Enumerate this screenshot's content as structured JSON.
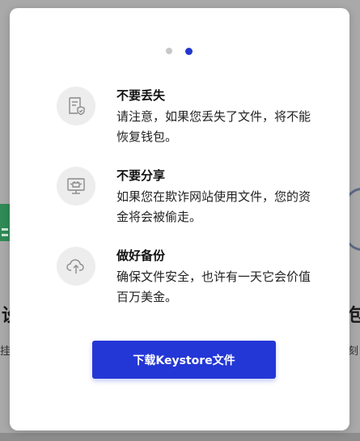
{
  "background": {
    "left_heading": "设",
    "left_sub": "挂",
    "right_heading": "包",
    "right_sub": "刻"
  },
  "pagination": {
    "total": 2,
    "active": 2
  },
  "items": [
    {
      "title": "不要丢失",
      "description": "请注意，如果您丢失了文件，将不能恢复钱包。",
      "icon": "document-shield-icon"
    },
    {
      "title": "不要分享",
      "description": "如果您在欺诈网站使用文件，您的资金将会被偷走。",
      "icon": "monitor-phishing-icon"
    },
    {
      "title": "做好备份",
      "description": "确保文件安全，也许有一天它会价值百万美金。",
      "icon": "cloud-upload-icon"
    }
  ],
  "download_button": {
    "label": "下载Keystore文件"
  },
  "colors": {
    "accent": "#2337d6",
    "dot_active": "#2337cf",
    "dot_inactive": "#c8c8c8",
    "icon_bg": "#ededed"
  }
}
